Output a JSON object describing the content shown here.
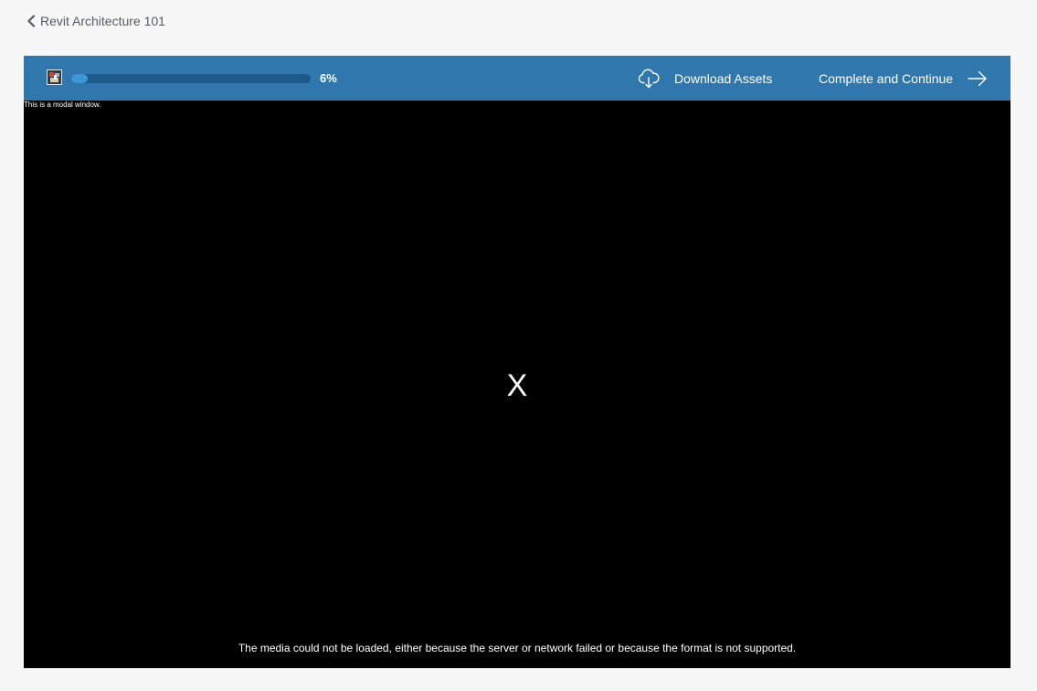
{
  "nav": {
    "back_label": "Revit Architecture 101",
    "back_icon": "chevron-left-icon"
  },
  "player_header": {
    "background_color": "#2f77ad",
    "progress": {
      "percent_label": "6%",
      "value_fraction": 0.06
    },
    "download_label": "Download Assets",
    "download_icon": "cloud-download-icon",
    "continue_label": "Complete and Continue",
    "continue_icon": "arrow-right-icon"
  },
  "video": {
    "modal_note": "This is a modal window.",
    "close_glyph": "X",
    "error_message": "The media could not be loaded, either because the server or network failed or because the format is not supported."
  }
}
